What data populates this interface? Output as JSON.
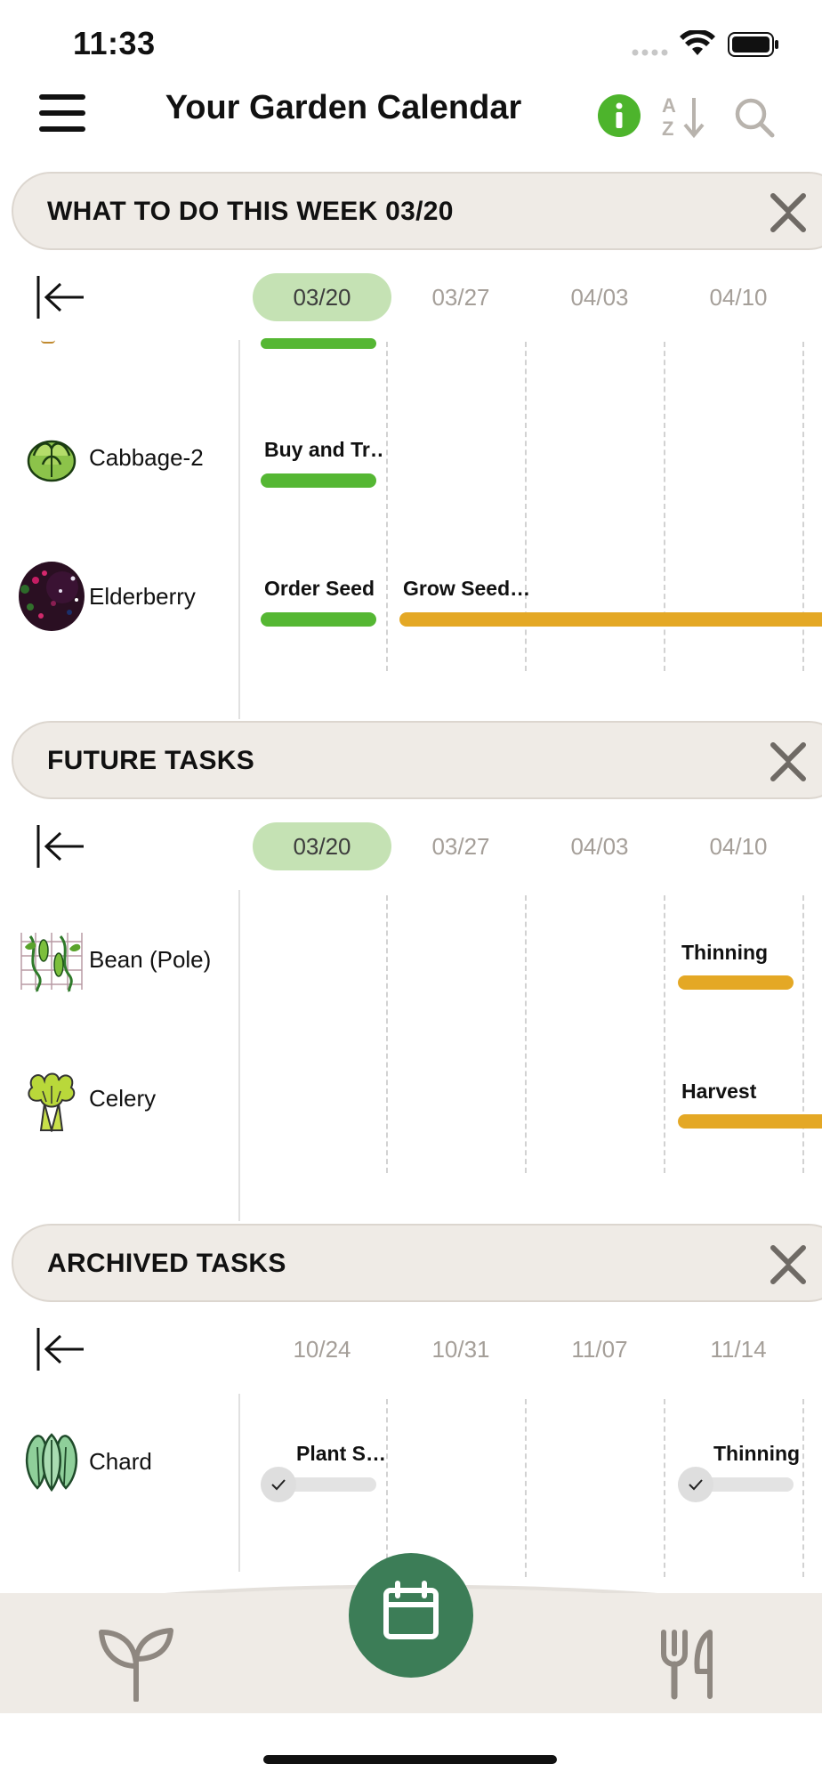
{
  "status_bar": {
    "time": "11:33"
  },
  "header": {
    "title": "Your Garden Calendar",
    "icons": [
      "menu-icon",
      "info-icon",
      "sort-az-icon",
      "search-icon"
    ]
  },
  "colors": {
    "accent_green": "#55b733",
    "accent_orange": "#e4a825",
    "fab_green": "#3c7d57",
    "active_date_bg": "#c5e2b4",
    "header_bg": "#efebe6"
  },
  "sections": {
    "this_week": {
      "title": "WHAT TO DO THIS WEEK 03/20",
      "dates": [
        "03/20",
        "03/27",
        "04/03",
        "04/10"
      ],
      "active_date": "03/20",
      "rows": [
        {
          "plant": "Cabbage-2",
          "icon": "cabbage-icon",
          "tasks": [
            {
              "label": "Buy and Tr…",
              "color": "green",
              "status": "active"
            }
          ]
        },
        {
          "plant": "Elderberry",
          "icon": "elderberry-photo",
          "tasks": [
            {
              "label": "Order Seed",
              "color": "green",
              "status": "active"
            },
            {
              "label": "Grow Seed…",
              "color": "orange",
              "status": "upcoming"
            }
          ]
        }
      ]
    },
    "future": {
      "title": "FUTURE TASKS",
      "dates": [
        "03/20",
        "03/27",
        "04/03",
        "04/10"
      ],
      "active_date": "03/20",
      "rows": [
        {
          "plant": "Bean (Pole)",
          "icon": "bean-trellis-icon",
          "tasks": [
            {
              "label": "Thinning",
              "color": "orange",
              "status": "upcoming"
            }
          ]
        },
        {
          "plant": "Celery",
          "icon": "celery-icon",
          "tasks": [
            {
              "label": "Harvest",
              "color": "orange",
              "status": "upcoming"
            }
          ]
        }
      ]
    },
    "archived": {
      "title": "ARCHIVED TASKS",
      "dates": [
        "10/24",
        "10/31",
        "11/07",
        "11/14"
      ],
      "rows": [
        {
          "plant": "Chard",
          "icon": "chard-icon",
          "tasks": [
            {
              "label": "Plant S…",
              "color": "grey",
              "status": "done"
            },
            {
              "label": "Thinning",
              "color": "grey",
              "status": "done"
            }
          ]
        }
      ]
    }
  },
  "bottom_nav": {
    "items": [
      "plant-icon",
      "calendar-icon",
      "fork-knife-icon"
    ],
    "active": "calendar-icon"
  }
}
